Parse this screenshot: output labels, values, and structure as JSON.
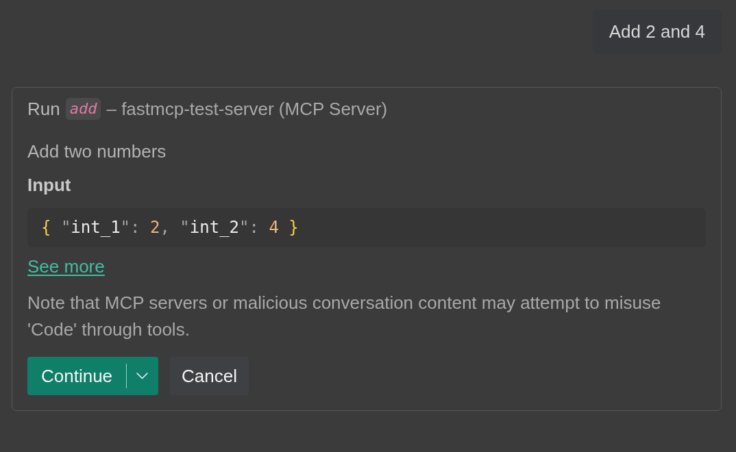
{
  "chat": {
    "user_message": "Add 2 and 4",
    "tool_confirmation": {
      "title": {
        "action": "Run",
        "tool": "add",
        "server": "– fastmcp-test-server (MCP Server)"
      },
      "description": "Add two numbers",
      "input_heading": "Input",
      "input_code": [
        {
          "kind": "brace",
          "text": "{"
        },
        {
          "kind": "punct",
          "text": " \""
        },
        {
          "kind": "key",
          "text": "int_1"
        },
        {
          "kind": "punct",
          "text": "\": "
        },
        {
          "kind": "number",
          "text": "2"
        },
        {
          "kind": "punct",
          "text": ", \""
        },
        {
          "kind": "key",
          "text": "int_2"
        },
        {
          "kind": "punct",
          "text": "\": "
        },
        {
          "kind": "number",
          "text": "4"
        },
        {
          "kind": "brace",
          "text": " }"
        }
      ],
      "see_more_link": "See more",
      "warning": "Note that MCP servers or malicious conversation content may attempt to misuse 'Code' through tools.",
      "buttons": [
        {
          "kind": "split",
          "label": "Continue"
        },
        {
          "kind": "plain",
          "label": "Cancel"
        }
      ]
    }
  }
}
